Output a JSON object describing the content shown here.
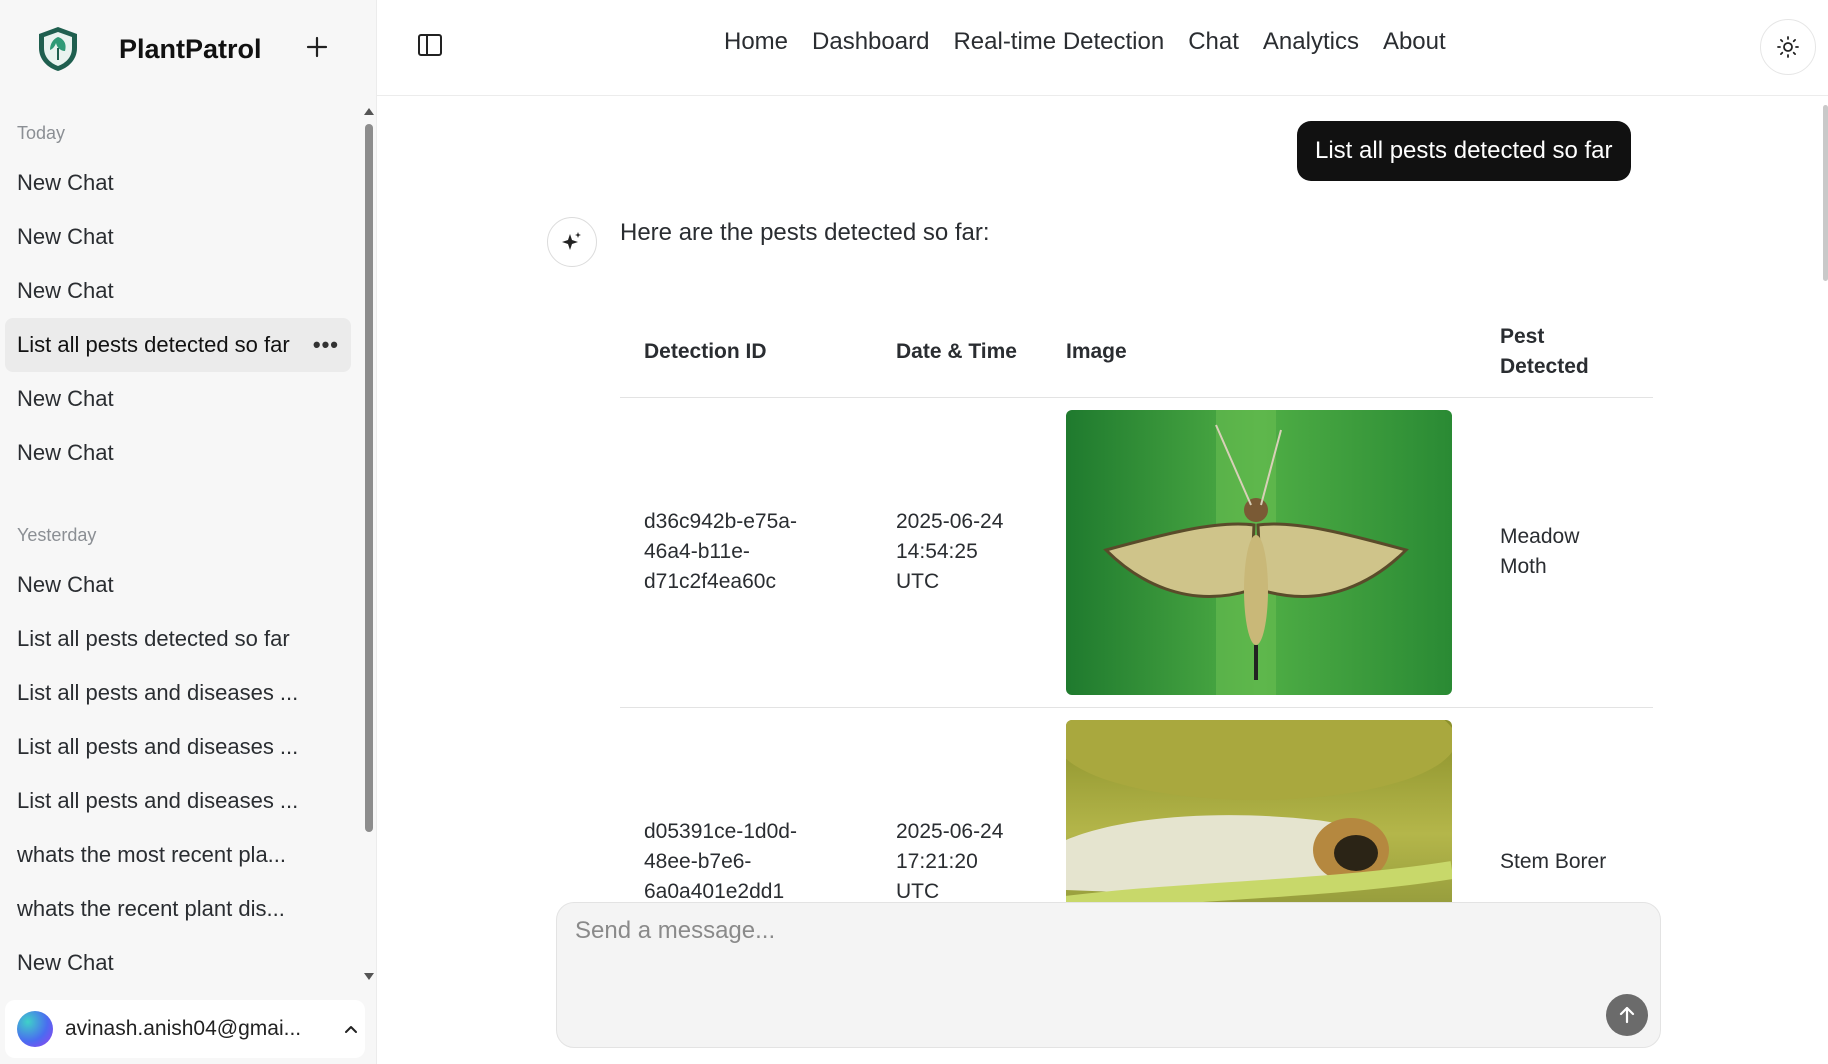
{
  "app": {
    "name": "PlantPatrol"
  },
  "sidebar": {
    "today_label": "Today",
    "yesterday_label": "Yesterday",
    "today_items": [
      {
        "label": "New Chat"
      },
      {
        "label": "New Chat"
      },
      {
        "label": "New Chat"
      },
      {
        "label": "List all pests detected so far",
        "active": true
      },
      {
        "label": "New Chat"
      },
      {
        "label": "New Chat"
      }
    ],
    "yesterday_items": [
      {
        "label": "New Chat"
      },
      {
        "label": "List all pests detected so far"
      },
      {
        "label": "List all pests and diseases ..."
      },
      {
        "label": "List all pests and diseases ..."
      },
      {
        "label": "List all pests and diseases ..."
      },
      {
        "label": "whats the most recent pla..."
      },
      {
        "label": "whats the recent plant dis..."
      },
      {
        "label": "New Chat"
      }
    ],
    "more_label": "•••",
    "user_email": "avinash.anish04@gmai..."
  },
  "header": {
    "nav": [
      "Home",
      "Dashboard",
      "Real-time Detection",
      "Chat",
      "Analytics",
      "About"
    ]
  },
  "chat": {
    "user_message": "List all pests detected so far",
    "assistant_intro": "Here are the pests detected so far:",
    "table": {
      "headers": [
        "Detection ID",
        "Date & Time",
        "Image",
        "Pest Detected"
      ],
      "rows": [
        {
          "id": "d36c942b-e75a-46a4-b11e-d71c2f4ea60c",
          "datetime": "2025-06-24 14:54:25 UTC",
          "pest": "Meadow Moth"
        },
        {
          "id": "d05391ce-1d0d-48ee-b7e6-6a0a401e2dd1",
          "datetime": "2025-06-24 17:21:20 UTC",
          "pest": "Stem Borer"
        }
      ]
    }
  },
  "composer": {
    "placeholder": "Send a message..."
  },
  "colors": {
    "accent": "#111111",
    "sidebar_bg": "#f7f7f7",
    "logo_green": "#1f7a63"
  },
  "icons": [
    "shield-logo-icon",
    "plus-icon",
    "sidebar-toggle-icon",
    "sun-icon",
    "sparkle-icon",
    "chevron-up-icon",
    "arrow-up-icon",
    "more-icon"
  ]
}
